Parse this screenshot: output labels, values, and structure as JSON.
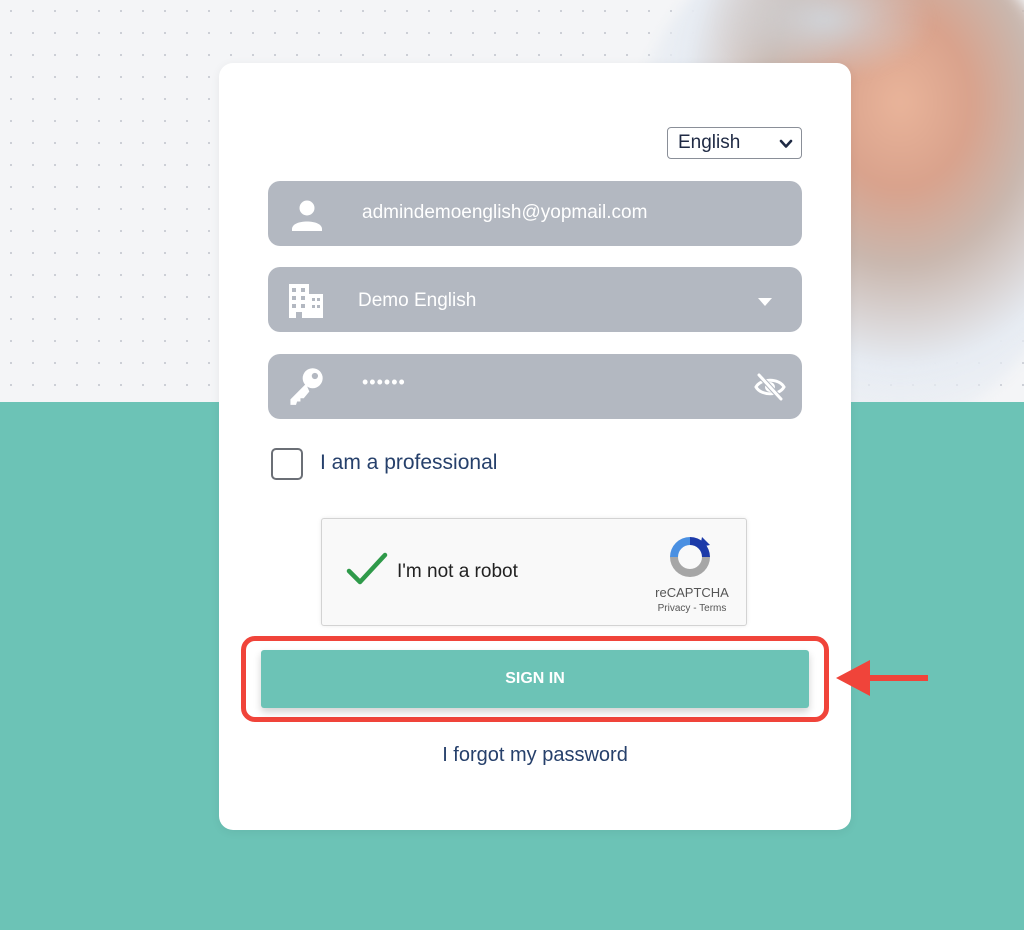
{
  "language_select": {
    "value": "English"
  },
  "email_field": {
    "value": "admindemoenglish@yopmail.com",
    "icon": "user-icon"
  },
  "company_select": {
    "value": "Demo English",
    "icon": "building-icon"
  },
  "password_field": {
    "value": "••••••",
    "icon": "key-icon",
    "toggle_icon": "eye-slash-icon"
  },
  "professional_checkbox": {
    "label": "I am a professional",
    "checked": false
  },
  "captcha": {
    "label": "I'm not a robot",
    "brand": "reCAPTCHA",
    "links": "Privacy - Terms",
    "checked": true
  },
  "sign_in": {
    "label": "SIGN IN"
  },
  "forgot_password": {
    "label": "I forgot my password"
  },
  "colors": {
    "accent": "#6cc3b6",
    "field_bg": "#b3b8c1",
    "highlight": "#f0443a",
    "link_text": "#26406b"
  }
}
